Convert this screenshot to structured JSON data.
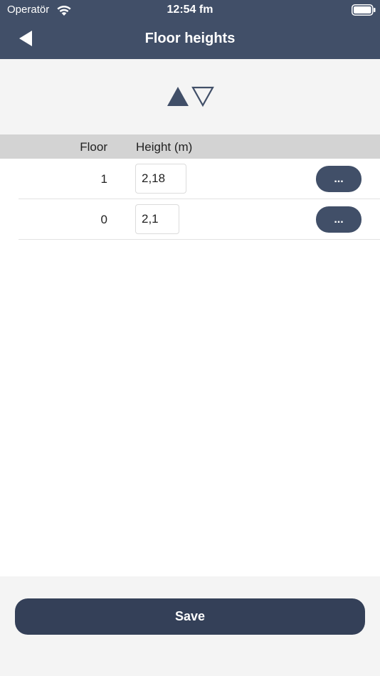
{
  "status_bar": {
    "carrier": "Operatör",
    "time": "12:54 fm",
    "wifi_icon": "wifi-icon",
    "battery_icon": "battery-icon"
  },
  "nav": {
    "title": "Floor heights",
    "back_icon": "back-arrow-icon"
  },
  "sort": {
    "ascending_icon": "triangle-up-filled-icon",
    "descending_icon": "triangle-down-outline-icon"
  },
  "table": {
    "headers": {
      "floor": "Floor",
      "height": "Height (m)"
    },
    "rows": [
      {
        "floor": "1",
        "height": "2,18",
        "more_label": "..."
      },
      {
        "floor": "0",
        "height": "2,1",
        "more_label": "..."
      }
    ]
  },
  "footer": {
    "save_label": "Save"
  },
  "colors": {
    "header_bg": "#414f68",
    "accent": "#414f68",
    "save_button": "#344058",
    "panel_bg": "#f4f4f4",
    "table_header_bg": "#d3d3d3"
  }
}
